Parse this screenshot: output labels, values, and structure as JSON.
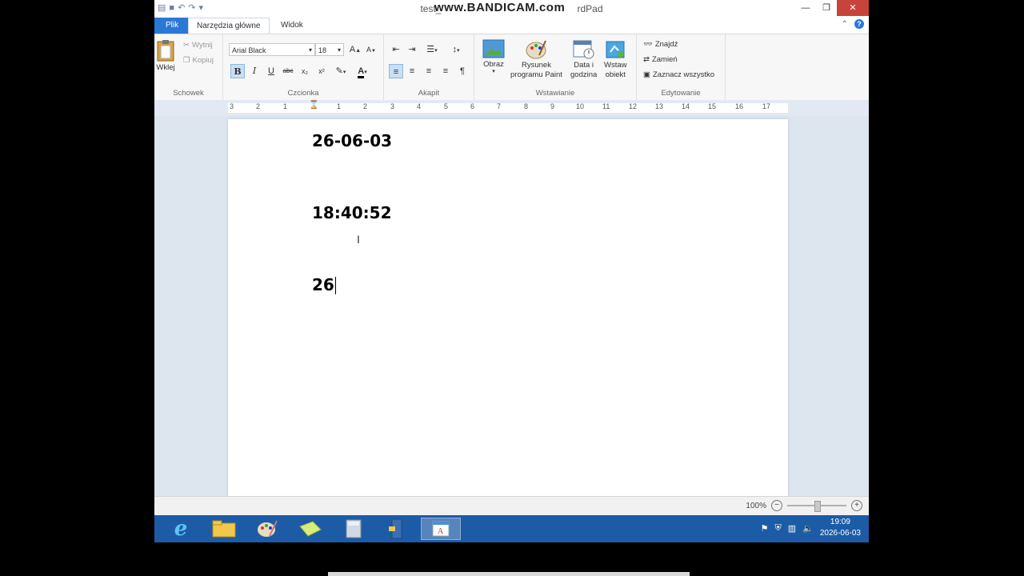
{
  "window": {
    "title_left": "test_",
    "title_right": "rdPad",
    "watermark": "www.BANDICAM.com",
    "controls": {
      "minimize": "—",
      "restore": "❐",
      "close": "✕"
    }
  },
  "tabs": [
    {
      "label": "Plik"
    },
    {
      "label": "Narzędzia główne"
    },
    {
      "label": "Widok"
    }
  ],
  "ribbon": {
    "clipboard": {
      "group_label": "Schowek",
      "paste_label": "Wklej",
      "cut_label": "Wytnij",
      "copy_label": "Kopiuj"
    },
    "font": {
      "group_label": "Czcionka",
      "font_family_value": "Arial Black",
      "font_size_value": "18",
      "bold": "B",
      "italic": "I",
      "underline": "U",
      "strikethrough": "abc",
      "subscript": "x₂",
      "superscript": "x²"
    },
    "paragraph": {
      "group_label": "Akapit"
    },
    "insert": {
      "group_label": "Wstawianie",
      "picture_label": "Obraz",
      "paint_label_line1": "Rysunek",
      "paint_label_line2": "programu Paint",
      "datetime_label_line1": "Data i",
      "datetime_label_line2": "godzina",
      "object_label_line1": "Wstaw",
      "object_label_line2": "obiekt"
    },
    "editing": {
      "group_label": "Edytowanie",
      "find_label": "Znajdź",
      "replace_label": "Zamień",
      "selectall_label": "Zaznacz wszystko"
    }
  },
  "ruler": {
    "ticks": [
      "3",
      "2",
      "1",
      "1",
      "2",
      "3",
      "4",
      "5",
      "6",
      "7",
      "8",
      "9",
      "10",
      "11",
      "12",
      "13",
      "14",
      "15",
      "16",
      "17"
    ]
  },
  "document": {
    "lines": [
      "26-06-03",
      "18:40:52",
      "26"
    ]
  },
  "status": {
    "zoom": "100%",
    "zoom_level_percent": 100,
    "zoom_out": "−",
    "zoom_in": "+"
  },
  "taskbar": {
    "time": "19:09",
    "date": "2026-06-03"
  },
  "colors": {
    "file_tab": "#2a78d6",
    "taskbar": "#1c5ca6",
    "close_button": "#c7443a"
  }
}
